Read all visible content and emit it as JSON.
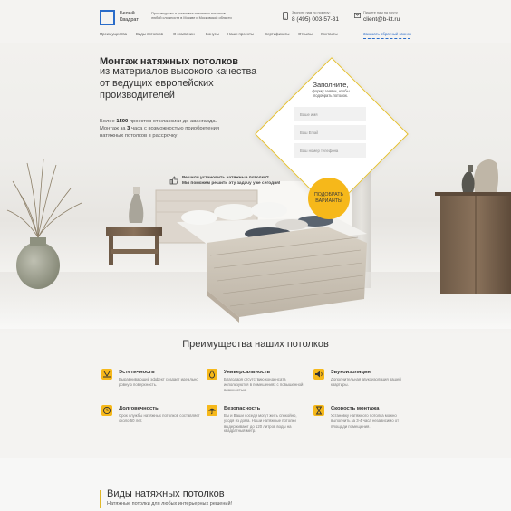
{
  "brand": {
    "line1": "Белый",
    "line2": "Квадрат"
  },
  "tagline": "Производство и установка натяжных потолков любой сложности в Москве и Московской области",
  "contacts": {
    "phone_caption": "Звоните нам по номеру:",
    "phone": "8 (495) 003-57-31",
    "email_caption": "Пишите нам на почту",
    "email": "client@b-kt.ru"
  },
  "nav": {
    "items": [
      "Преимущества",
      "Виды потолков",
      "О компании",
      "Бонусы",
      "Наши проекты",
      "Сертификаты",
      "Отзывы",
      "Контакты"
    ],
    "callback": "Заказать обратный звонок"
  },
  "hero": {
    "title": "Монтаж натяжных потолков",
    "subtitle_lines": [
      "из материалов высокого качества",
      "от ведущих европейских",
      "производителей"
    ],
    "desc_line1_a": "Более ",
    "desc_line1_b": "1500",
    "desc_line1_c": " проектов от классики до авангарда.",
    "desc_line2_a": "Монтаж за ",
    "desc_line2_b": "3",
    "desc_line2_c": " часа с возможностью приобретения",
    "desc_line3": "натяжных потолков в рассрочку"
  },
  "form": {
    "title": "Заполните,",
    "note_line1": "форму заявки, чтобы",
    "note_line2": "подобрать потолок.",
    "name_placeholder": "Ваше имя",
    "email_placeholder": "Ваш Email",
    "phone_placeholder": "Ваш номер телефона",
    "button_line1": "ПОДОБРАТЬ",
    "button_line2": "ВАРИАНТЫ"
  },
  "cta": {
    "line1": "Решили установить натяжные потолки?",
    "line2": "Мы поможем решить эту задачу уже сегодня!"
  },
  "benefits": {
    "title": "Преимущества наших потолков",
    "items": [
      {
        "title": "Эстетичность",
        "text": "Выравнивающий эффект создает идеально ровную поверхность."
      },
      {
        "title": "Универсальность",
        "text": "Благодаря отсутствию конденсата используются в помещениях с повышенной влажностью."
      },
      {
        "title": "Звукоизоляция",
        "text": "Дополнительная звукоизоляция вашей квартиры."
      },
      {
        "title": "Долговечность",
        "text": "Срок службы натяжных потолков составляет около 50 лет."
      },
      {
        "title": "Безопасность",
        "text": "Вы и Ваши соседи могут жить спокойно, уходя из дома. Наши натяжные потолки выдерживают до 120 литров воды на квадратный метр."
      },
      {
        "title": "Скорость монтажа",
        "text": "Установку натяжного потолка можно выполнить за 3-4 часа независимо от площади помещения."
      }
    ]
  },
  "types": {
    "title": "Виды натяжных потолков",
    "subtitle": "Натяжные потолки для любых интерьерных решений!"
  },
  "colors": {
    "accent": "#f6b81a",
    "brand_blue": "#2a6cc9"
  }
}
